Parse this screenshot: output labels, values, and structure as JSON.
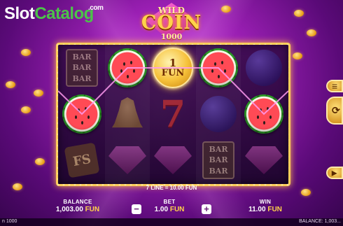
{
  "site_logo": {
    "part1": "Slot",
    "part2": "Catalog",
    "suffix": ".com"
  },
  "game_logo": {
    "top": "WILD",
    "main": "COIN",
    "bottom": "1000"
  },
  "reels": {
    "columns": [
      [
        {
          "type": "bar",
          "text": [
            "BAR",
            "BAR",
            "BAR"
          ]
        },
        {
          "type": "melon"
        },
        {
          "type": "fs",
          "text": "FS"
        }
      ],
      [
        {
          "type": "melon"
        },
        {
          "type": "bell"
        },
        {
          "type": "gem"
        }
      ],
      [
        {
          "type": "coin",
          "value": "1",
          "currency": "FUN"
        },
        {
          "type": "seven",
          "text": "7"
        },
        {
          "type": "gem"
        }
      ],
      [
        {
          "type": "melon"
        },
        {
          "type": "plum"
        },
        {
          "type": "bar",
          "text": [
            "BAR",
            "BAR",
            "BAR"
          ]
        }
      ],
      [
        {
          "type": "plum"
        },
        {
          "type": "melon"
        },
        {
          "type": "gem"
        }
      ]
    ]
  },
  "win_line_text": "7 LINE = 10.00 FUN",
  "balance": {
    "label": "BALANCE",
    "amount": "1,003.00",
    "currency": "FUN"
  },
  "bet": {
    "label": "BET",
    "amount": "1.00",
    "currency": "FUN",
    "minus": "−",
    "plus": "+"
  },
  "win": {
    "label": "WIN",
    "amount": "11.00",
    "currency": "FUN"
  },
  "footer": {
    "left": "n 1000",
    "right": "BALANCE: 1,003..."
  },
  "icons": {
    "side_top": "menu-icon",
    "side_middle": "spin-icon",
    "side_bottom": "autoplay-icon"
  }
}
